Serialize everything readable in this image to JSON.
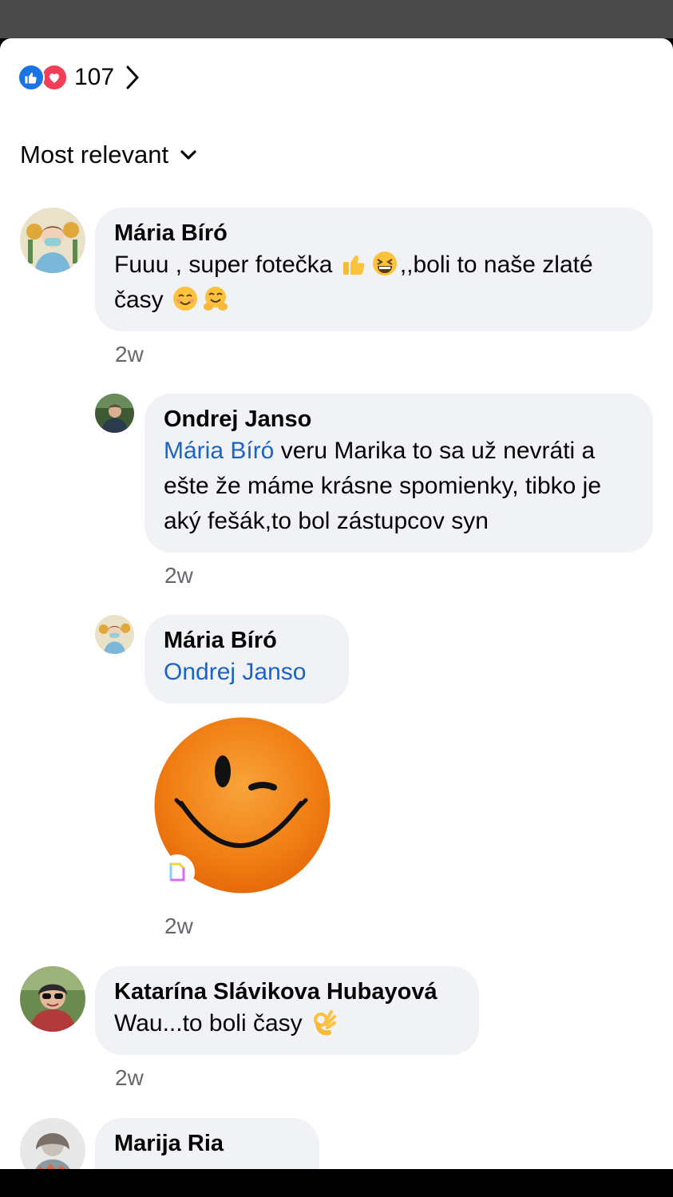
{
  "reactions": {
    "count": "107",
    "icons": [
      "like-icon",
      "love-icon"
    ]
  },
  "sort": {
    "label": "Most relevant"
  },
  "comments": [
    {
      "author": "Mária Bíró",
      "text_a": "Fuuu , super fotečka ",
      "text_b": ",,boli to naše zlaté časy ",
      "emojis": [
        "thumbs-up-emoji",
        "grinning-squinting-emoji",
        "smiling-emoji",
        "hugging-emoji"
      ],
      "time": "2w"
    },
    {
      "author": "Ondrej Janso",
      "mention": "Mária Bíró",
      "text": " veru Marika to sa už nevráti a ešte že máme krásne spomienky, tibko je aký fešák,to bol zástupcov syn",
      "time": "2w"
    },
    {
      "author": "Mária Bíró",
      "mention": "Ondrej Janso",
      "sticker": "winking-smiley-sticker",
      "time": "2w"
    },
    {
      "author": "Katarína Slávikova Hubayová",
      "text": "Wau...to boli časy ",
      "emojis": [
        "ok-hand-emoji"
      ],
      "time": "2w"
    },
    {
      "author": "Marija Ria"
    }
  ],
  "colors": {
    "like": "#1b74e4",
    "love": "#f33e58",
    "mention": "#1b64c7",
    "bubble": "#f0f2f5",
    "meta": "#65676b"
  }
}
